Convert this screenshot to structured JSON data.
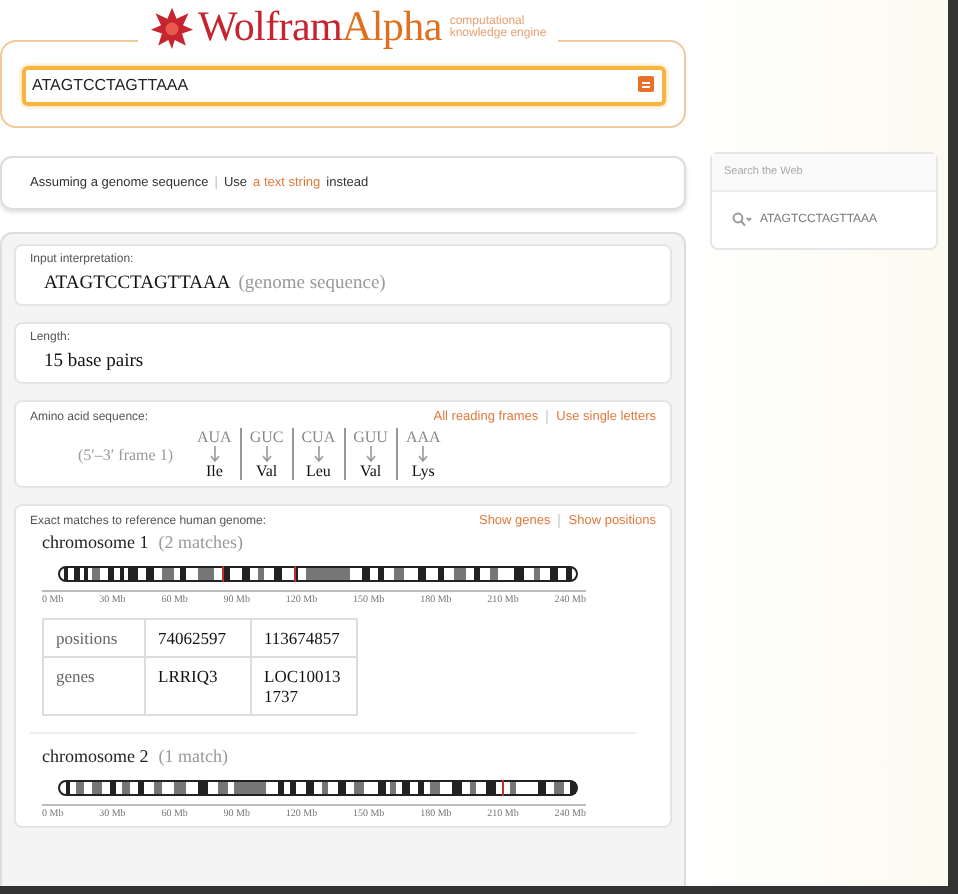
{
  "logo": {
    "brand_a": "Wolfram",
    "brand_b": "Alpha",
    "tagline_1": "computational",
    "tagline_2": "knowledge engine"
  },
  "search": {
    "value": "ATAGTCCTAGTTAAA"
  },
  "assumption": {
    "text": "Assuming a genome sequence",
    "separator": "|",
    "prefix": "Use",
    "link": "a text string",
    "suffix": "instead"
  },
  "web_search": {
    "title": "Search the Web",
    "query": "ATAGTCCTAGTTAAA"
  },
  "pods": [
    {
      "kind": "text",
      "title": "Input interpretation:",
      "value": "ATAGTCCTAGTTAAA",
      "note": "(genome sequence)"
    },
    {
      "kind": "text",
      "title": "Length:",
      "value": "15 base pairs"
    },
    {
      "kind": "codons",
      "title": "Amino acid sequence:",
      "links": [
        "All reading frames",
        "Use single letters"
      ],
      "frame": "(5′–3′  frame 1)",
      "codons": [
        {
          "codon": "AUA",
          "amino": "Ile"
        },
        {
          "codon": "GUC",
          "amino": "Val"
        },
        {
          "codon": "CUA",
          "amino": "Leu"
        },
        {
          "codon": "GUU",
          "amino": "Val"
        },
        {
          "codon": "AAA",
          "amino": "Lys"
        }
      ]
    },
    {
      "kind": "genome",
      "title": "Exact matches to reference human genome:",
      "links": [
        "Show genes",
        "Show positions"
      ],
      "chromosomes": [
        {
          "name": "chromosome 1",
          "count": "(2 matches)",
          "ticks": [
            "0 Mb",
            "30 Mb",
            "60 Mb",
            "90 Mb",
            "120 Mb",
            "150 Mb",
            "180 Mb",
            "210 Mb",
            "240 Mb"
          ],
          "table": [
            {
              "label": "positions",
              "values": [
                "74062597",
                "113674857"
              ]
            },
            {
              "label": "genes",
              "values": [
                "LRRIQ3",
                "LOC100131737"
              ]
            }
          ]
        },
        {
          "name": "chromosome 2",
          "count": "(1 match)",
          "ticks": [
            "0 Mb",
            "30 Mb",
            "60 Mb",
            "90 Mb",
            "120 Mb",
            "150 Mb",
            "180 Mb",
            "210 Mb",
            "240 Mb"
          ]
        }
      ]
    }
  ]
}
